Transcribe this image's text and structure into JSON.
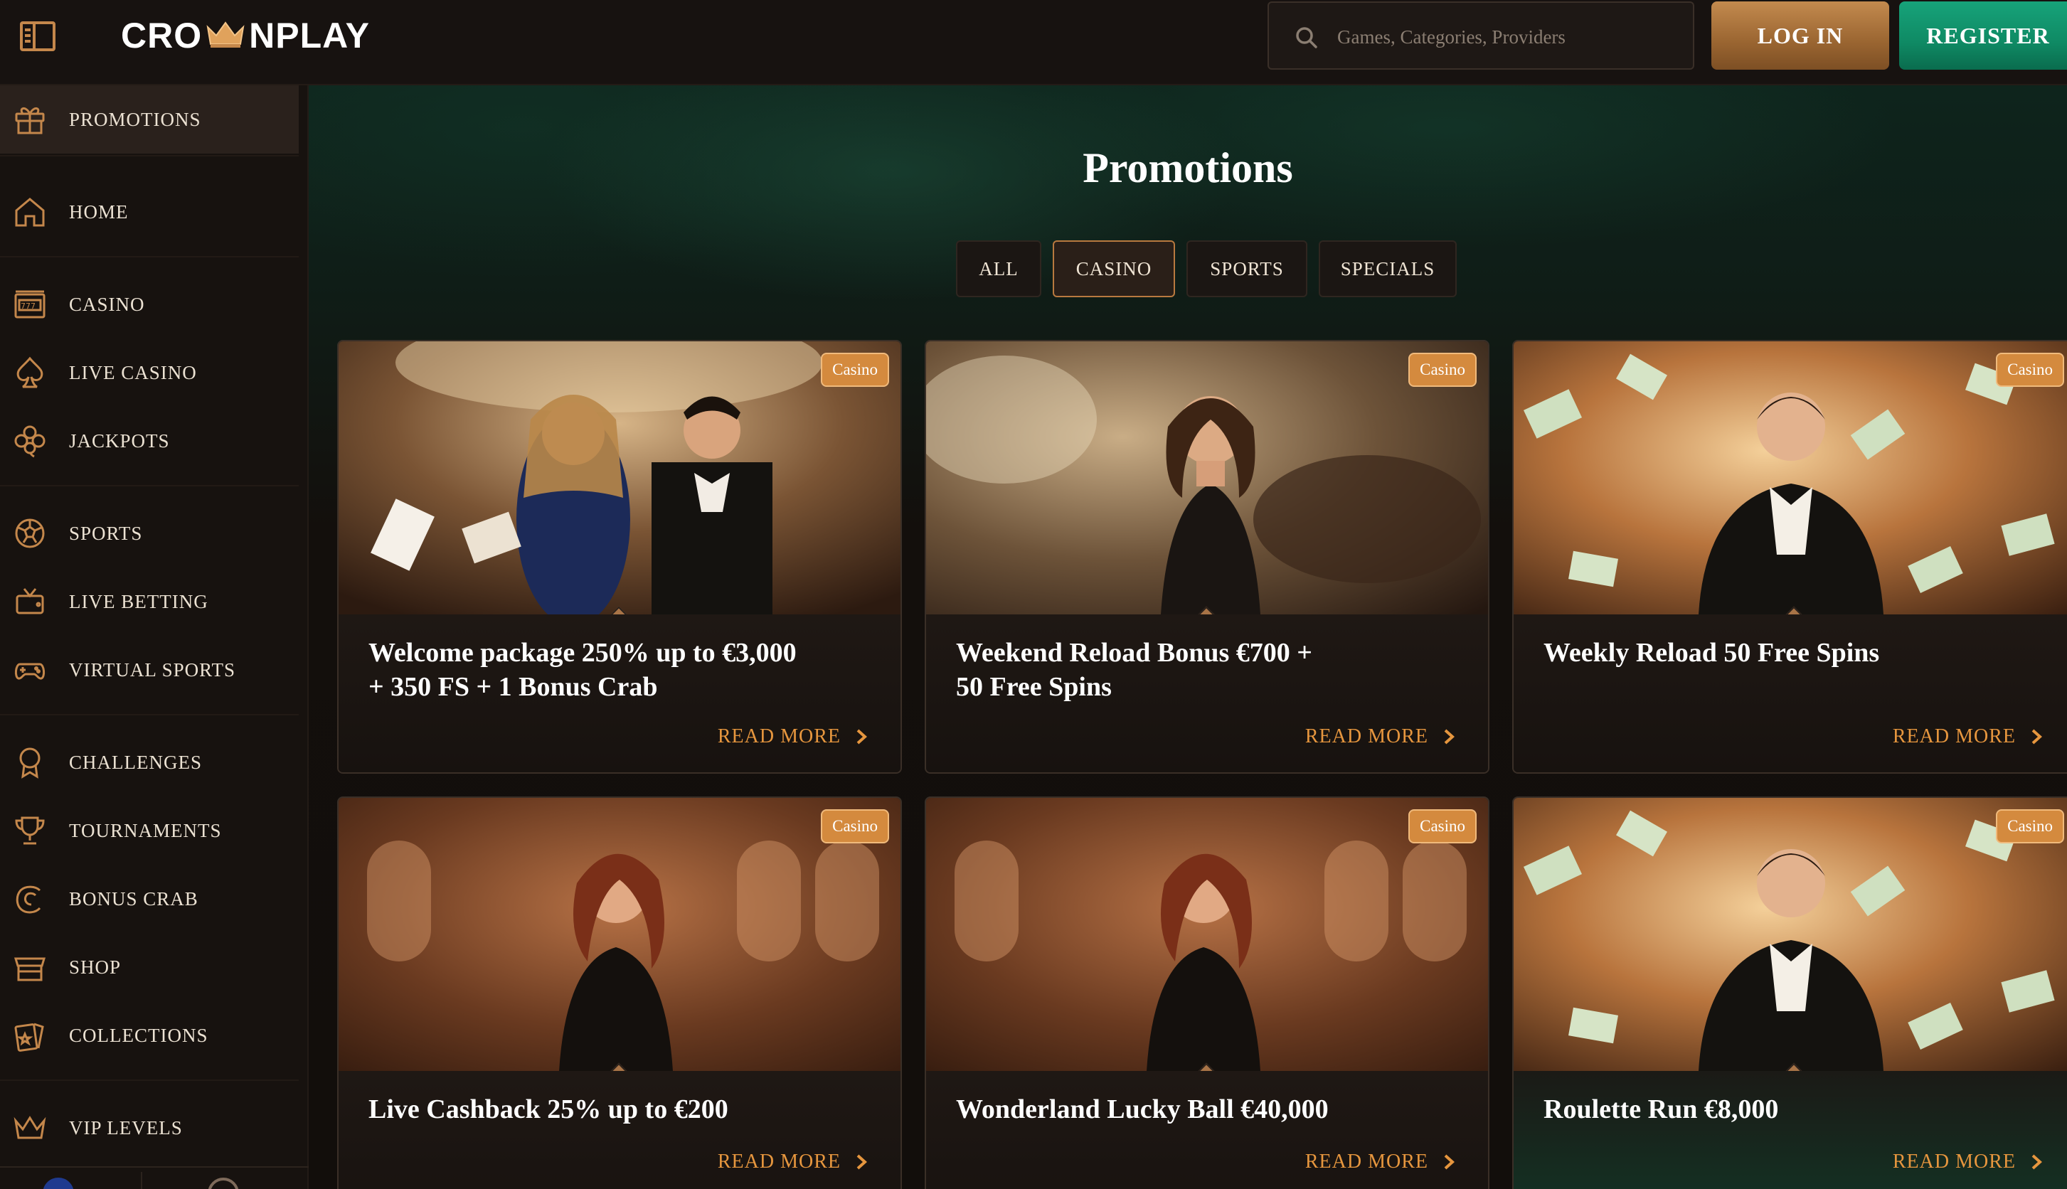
{
  "header": {
    "logo_text_left": "CRO",
    "logo_text_right": "NPLAY",
    "search_placeholder": "Games, Categories, Providers",
    "login_label": "LOG IN",
    "register_label": "REGISTER"
  },
  "sidebar": {
    "items": [
      {
        "label": "PROMOTIONS",
        "icon": "gift-icon"
      },
      {
        "label": "HOME",
        "icon": "home-icon"
      },
      {
        "label": "CASINO",
        "icon": "slot-machine-icon"
      },
      {
        "label": "LIVE CASINO",
        "icon": "spade-icon"
      },
      {
        "label": "JACKPOTS",
        "icon": "clover-icon"
      },
      {
        "label": "SPORTS",
        "icon": "soccer-ball-icon"
      },
      {
        "label": "LIVE BETTING",
        "icon": "tv-icon"
      },
      {
        "label": "VIRTUAL SPORTS",
        "icon": "gamepad-icon"
      },
      {
        "label": "CHALLENGES",
        "icon": "medal-icon"
      },
      {
        "label": "TOURNAMENTS",
        "icon": "trophy-icon"
      },
      {
        "label": "BONUS CRAB",
        "icon": "bonus-crab-icon"
      },
      {
        "label": "SHOP",
        "icon": "shop-icon"
      },
      {
        "label": "COLLECTIONS",
        "icon": "collection-icon"
      },
      {
        "label": "VIP LEVELS",
        "icon": "crown-icon"
      }
    ]
  },
  "main": {
    "title": "Promotions",
    "tabs": [
      {
        "label": "ALL",
        "active": false
      },
      {
        "label": "CASINO",
        "active": true
      },
      {
        "label": "SPORTS",
        "active": false
      },
      {
        "label": "SPECIALS",
        "active": false
      }
    ],
    "cards": [
      {
        "badge": "Casino",
        "title_line1": "Welcome package 250% up to €3,000",
        "title_line2": "+ 350 FS + 1 Bonus Crab",
        "more": "READ MORE"
      },
      {
        "badge": "Casino",
        "title_line1": "Weekend Reload Bonus €700 +",
        "title_line2": "50 Free Spins",
        "more": "READ MORE"
      },
      {
        "badge": "Casino",
        "title_line1": "Weekly Reload 50 Free Spins",
        "title_line2": "",
        "more": "READ MORE"
      },
      {
        "badge": "Casino",
        "title_line1": "Live Cashback 25% up to €200",
        "title_line2": "",
        "more": "READ MORE"
      },
      {
        "badge": "Casino",
        "title_line1": "Wonderland Lucky Ball €40,000",
        "title_line2": "",
        "more": "READ MORE"
      },
      {
        "badge": "Casino",
        "title_line1": "Roulette Run €8,000",
        "title_line2": "",
        "more": "READ MORE"
      }
    ]
  },
  "colors": {
    "accent_gold": "#c4874b",
    "read_more": "#e6963e",
    "register_green": "#0f8a64",
    "badge": "#d48a3e"
  }
}
